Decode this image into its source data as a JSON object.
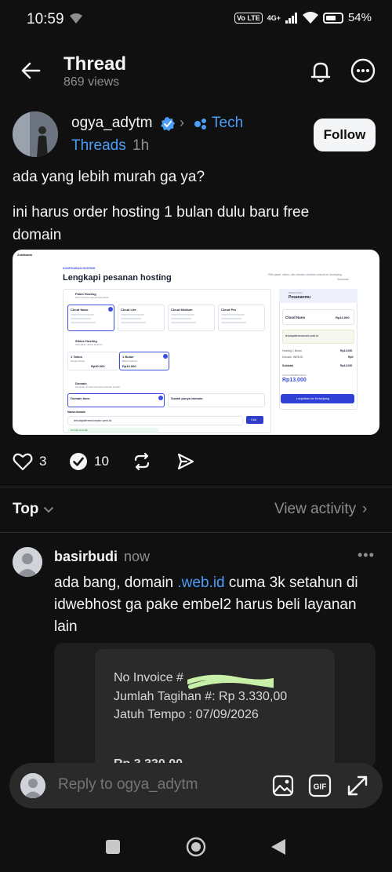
{
  "status_bar": {
    "time": "10:59",
    "volte": "Vo LTE",
    "network": "4G+",
    "battery": "54%"
  },
  "header": {
    "title": "Thread",
    "views": "869 views"
  },
  "post": {
    "author": "ogya_adytm",
    "topic": "Tech",
    "source": "Threads",
    "time": "1h",
    "follow_label": "Follow",
    "text_line1": "ada yang lebih murah ga ya?",
    "text_line2": "ini harus order hosting 1 bulan dulu baru free domain",
    "likes": "3",
    "replies": "10",
    "image": {
      "brand": "Zoidkanta",
      "kicker": "KONFIGURASI HOSTING",
      "title": "Lengkapi pesanan hosting",
      "subtitle": "Pilih paket, siklus, dan domain sebelum masuk ke keranjang",
      "subtitle2": "Zonkanta",
      "section1_title": "Paket Hosting",
      "section1_sub": "Pilih resource sesuai kebutuhan",
      "plans": [
        "Cloud Nano",
        "Cloud Lite",
        "Cloud Medium",
        "Cloud Pro"
      ],
      "section2_title": "Siklus Hosting",
      "section2_sub": "Sesuaikan durasi layanan",
      "cycles": [
        {
          "name": "1 Tahun",
          "price": "Rp90.000",
          "sub": "Harga terbaik"
        },
        {
          "name": "1 Bulan",
          "price": "Rp13.000",
          "sub": "Bayar bulanan"
        }
      ],
      "section3_title": "Domain",
      "section3_sub": "Gunakan domain baru atau domain sendiri",
      "domain_options": [
        "Domain baru",
        "Sudah punya domain"
      ],
      "domain_label": "Nama domain",
      "domain_value": "lehdapatfreedomain.web.id",
      "domain_btn": "Cek",
      "domain_note": "Domain tersedia",
      "summary_kicker": "RINGKASAN",
      "summary_title": "Pesananmu",
      "summary_plan": "Cloud Nano",
      "summary_plan_price": "Rp13.000",
      "summary_rows": [
        {
          "label": "Hosting 1 Bulan",
          "value": "Rp13.000"
        },
        {
          "label": "Domain .WEB.ID",
          "value": "Rp0"
        },
        {
          "label": "Subtotal",
          "value": "Rp13.000"
        }
      ],
      "summary_total_label": "TOTAL PEMBAYARAN",
      "summary_total": "Rp13.000",
      "summary_btn": "Lanjutkan ke Keranjang"
    }
  },
  "sort": {
    "label": "Top",
    "view_activity": "View activity"
  },
  "reply": {
    "author": "basirbudi",
    "time": "now",
    "text_before": "ada bang, domain ",
    "text_link": ".web.id",
    "text_after": " cuma 3k setahun di idwebhost ga pake embel2 harus beli layanan lain",
    "invoice": {
      "no_label": "No Invoice #",
      "amount": "Jumlah Tagihan #: Rp 3.330,00",
      "due": "Jatuh Tempo : 07/09/2026",
      "partial": "Rp 3.330,00"
    }
  },
  "composer": {
    "placeholder": "Reply to ogya_adytm"
  },
  "colors": {
    "background": "#101010",
    "accent_blue": "#4a9df8",
    "muted": "#8e8e8e"
  }
}
